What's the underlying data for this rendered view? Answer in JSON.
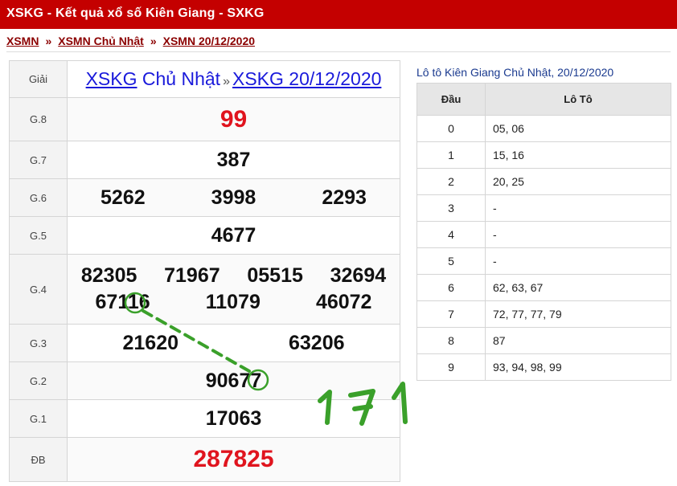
{
  "header": {
    "title": "XSKG - Kết quả xổ số Kiên Giang - SXKG"
  },
  "breadcrumb": {
    "items": [
      "XSMN",
      "XSMN Chủ Nhật",
      "XSMN 20/12/2020"
    ],
    "separator": "»"
  },
  "results": {
    "header": {
      "label": "Giải",
      "link1": "XSKG",
      "day": "Chủ Nhật",
      "sep": "»",
      "link2": "XSKG 20/12/2020"
    },
    "g8": {
      "label": "G.8",
      "value": "99"
    },
    "g7": {
      "label": "G.7",
      "value": "387"
    },
    "g6": {
      "label": "G.6",
      "values": [
        "5262",
        "3998",
        "2293"
      ]
    },
    "g5": {
      "label": "G.5",
      "value": "4677"
    },
    "g4": {
      "label": "G.4",
      "values": [
        "82305",
        "71967",
        "05515",
        "32694",
        "67116",
        "11079",
        "46072"
      ]
    },
    "g3": {
      "label": "G.3",
      "values": [
        "21620",
        "63206"
      ]
    },
    "g2": {
      "label": "G.2",
      "value": "90677"
    },
    "g1": {
      "label": "G.1",
      "value": "17063"
    },
    "db": {
      "label": "ĐB",
      "value": "287825"
    }
  },
  "loto": {
    "title": "Lô tô Kiên Giang Chủ Nhật, 20/12/2020",
    "col_dau": "Đầu",
    "col_loto": "Lô Tô",
    "rows": [
      {
        "dau": "0",
        "loto": "05, 06"
      },
      {
        "dau": "1",
        "loto": "15, 16"
      },
      {
        "dau": "2",
        "loto": "20, 25"
      },
      {
        "dau": "3",
        "loto": "-"
      },
      {
        "dau": "4",
        "loto": "-"
      },
      {
        "dau": "5",
        "loto": "-"
      },
      {
        "dau": "6",
        "loto": "62, 63, 67"
      },
      {
        "dau": "7",
        "loto": "72, 77, 77, 79"
      },
      {
        "dau": "8",
        "loto": "87"
      },
      {
        "dau": "9",
        "loto": "93, 94, 98, 99"
      }
    ]
  },
  "annotation": {
    "text": "171",
    "color": "#3aa02a"
  }
}
